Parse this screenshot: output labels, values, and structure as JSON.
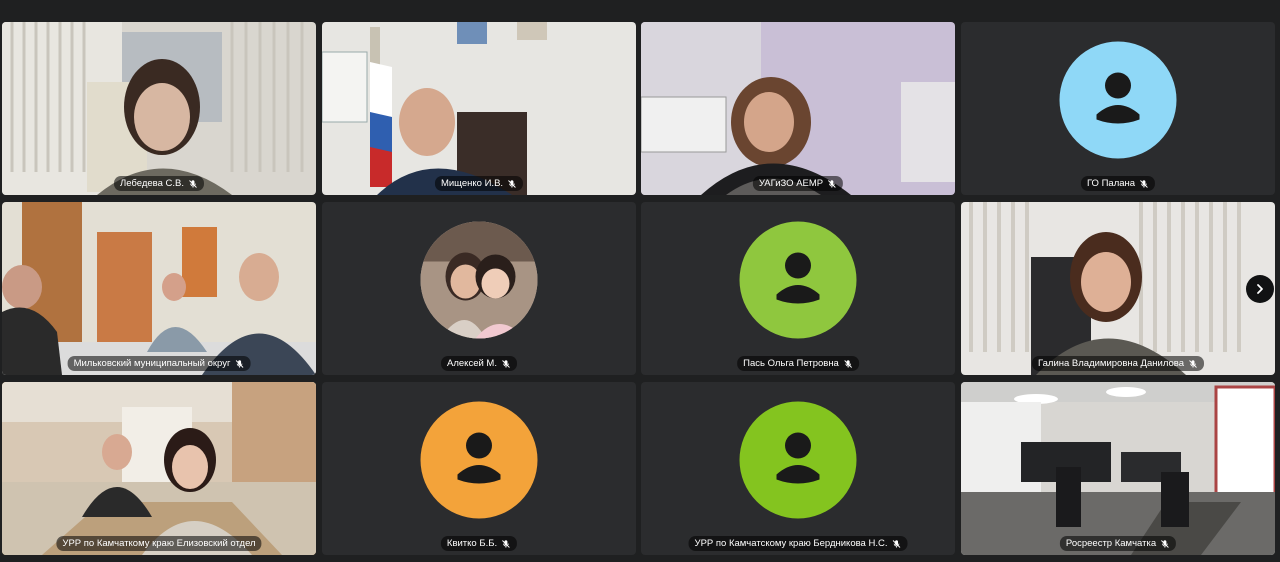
{
  "colors": {
    "background": "#1f2021",
    "active_speaker_border": "#f2c94c",
    "avatar_light_blue": "#8fd8f7",
    "avatar_green": "#8fc73e",
    "avatar_orange": "#f3a33a",
    "avatar_lime": "#84c41f"
  },
  "participants": [
    {
      "name": "Лебедева С.В.",
      "mic": "muted",
      "type": "video"
    },
    {
      "name": "Мищенко И.В.",
      "mic": "muted",
      "type": "video"
    },
    {
      "name": "УАГиЗО АЕМР",
      "mic": "muted",
      "type": "video"
    },
    {
      "name": "ГО Палана",
      "mic": "muted",
      "type": "avatar",
      "avatar_color": "#8fd8f7"
    },
    {
      "name": "Мильковский муниципальный округ",
      "mic": "muted",
      "type": "video"
    },
    {
      "name": "Алексей М.",
      "mic": "muted",
      "type": "photo-avatar"
    },
    {
      "name": "Пась Ольга Петровна",
      "mic": "muted",
      "type": "avatar",
      "avatar_color": "#8fc73e"
    },
    {
      "name": "Галина Владимировна Данилова",
      "mic": "muted",
      "type": "video"
    },
    {
      "name": "УРР по Камчаткому краю Елизовский отдел",
      "mic": "muted",
      "type": "video",
      "active": true
    },
    {
      "name": "Квитко Б.Б.",
      "mic": "muted",
      "type": "avatar",
      "avatar_color": "#f3a33a"
    },
    {
      "name": "УРР по Камчатскому краю Бердникова Н.С.",
      "mic": "muted",
      "type": "avatar",
      "avatar_color": "#84c41f"
    },
    {
      "name": "Росреестр Камчатка",
      "mic": "muted",
      "type": "video"
    }
  ],
  "controls": {
    "next_page_icon": "chevron-right-icon"
  }
}
